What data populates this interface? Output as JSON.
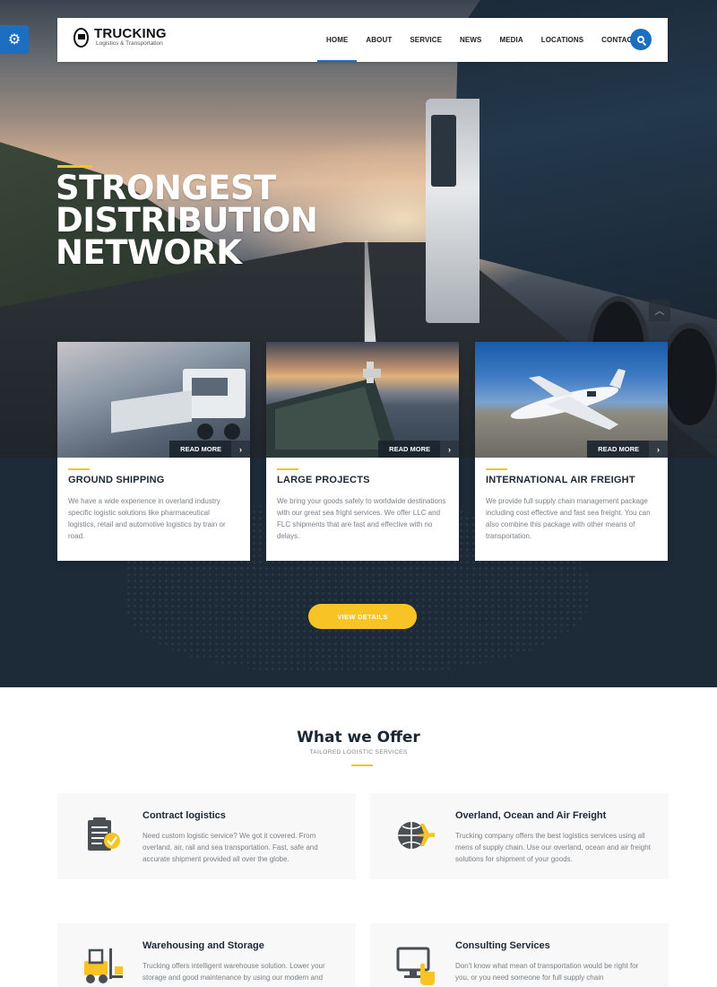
{
  "header": {
    "brand_title": "TRUCKING",
    "brand_subtitle": "Logistics & Transportation",
    "nav": [
      {
        "label": "HOME"
      },
      {
        "label": "ABOUT"
      },
      {
        "label": "SERVICE"
      },
      {
        "label": "NEWS"
      },
      {
        "label": "MEDIA"
      },
      {
        "label": "LOCATIONS"
      },
      {
        "label": "CONTACT"
      }
    ],
    "active_nav": "HOME"
  },
  "hero": {
    "title_lines": [
      "STRONGEST",
      "DISTRIBUTION",
      "NETWORK"
    ]
  },
  "cards": [
    {
      "read_more": "READ MORE",
      "title": "GROUND SHIPPING",
      "text": "We have a wide experience in overland industry specific logistic solutions like pharmaceutical logistics, retail and automotive logistics by train or road."
    },
    {
      "read_more": "READ MORE",
      "title": "LARGE PROJECTS",
      "text": "We bring your goods safely to worldwide destinations with our great sea fright services. We offer LLC and FLC shipments that are fast and effective with no delays."
    },
    {
      "read_more": "READ MORE",
      "title": "INTERNATIONAL AIR FREIGHT",
      "text": "We provide full supply chain management package including cost effective and fast sea freight. You can also combine this package with other means of transportation."
    }
  ],
  "view_details": "VIEW DETAILS",
  "offer": {
    "title": "What we Offer",
    "subtitle": "TAILORED LOGISTIC SERVICES",
    "items": [
      {
        "title": "Contract logistics",
        "text": "Need custom logistic service? We got it covered. From overland, air, rail and sea transportation. Fast, safe and accurate shipment provided all over the globe."
      },
      {
        "title": "Overland, Ocean and Air Freight",
        "text": "Trucking company offers the best logistics services using all mens of supply chain. Use our overland, ocean and air freight solutions for shipment of your goods."
      },
      {
        "title": "Warehousing and Storage",
        "text": "Trucking offers intelligent warehouse solution. Lower your storage and good maintenance by using our modern and"
      },
      {
        "title": "Consulting Services",
        "text": "Don't know what mean of transportation would be right for you, or you need someone for full supply chain"
      }
    ]
  },
  "colors": {
    "accent": "#f7c325",
    "primary": "#1c6ec1",
    "dark_section": "#1d2a38"
  }
}
